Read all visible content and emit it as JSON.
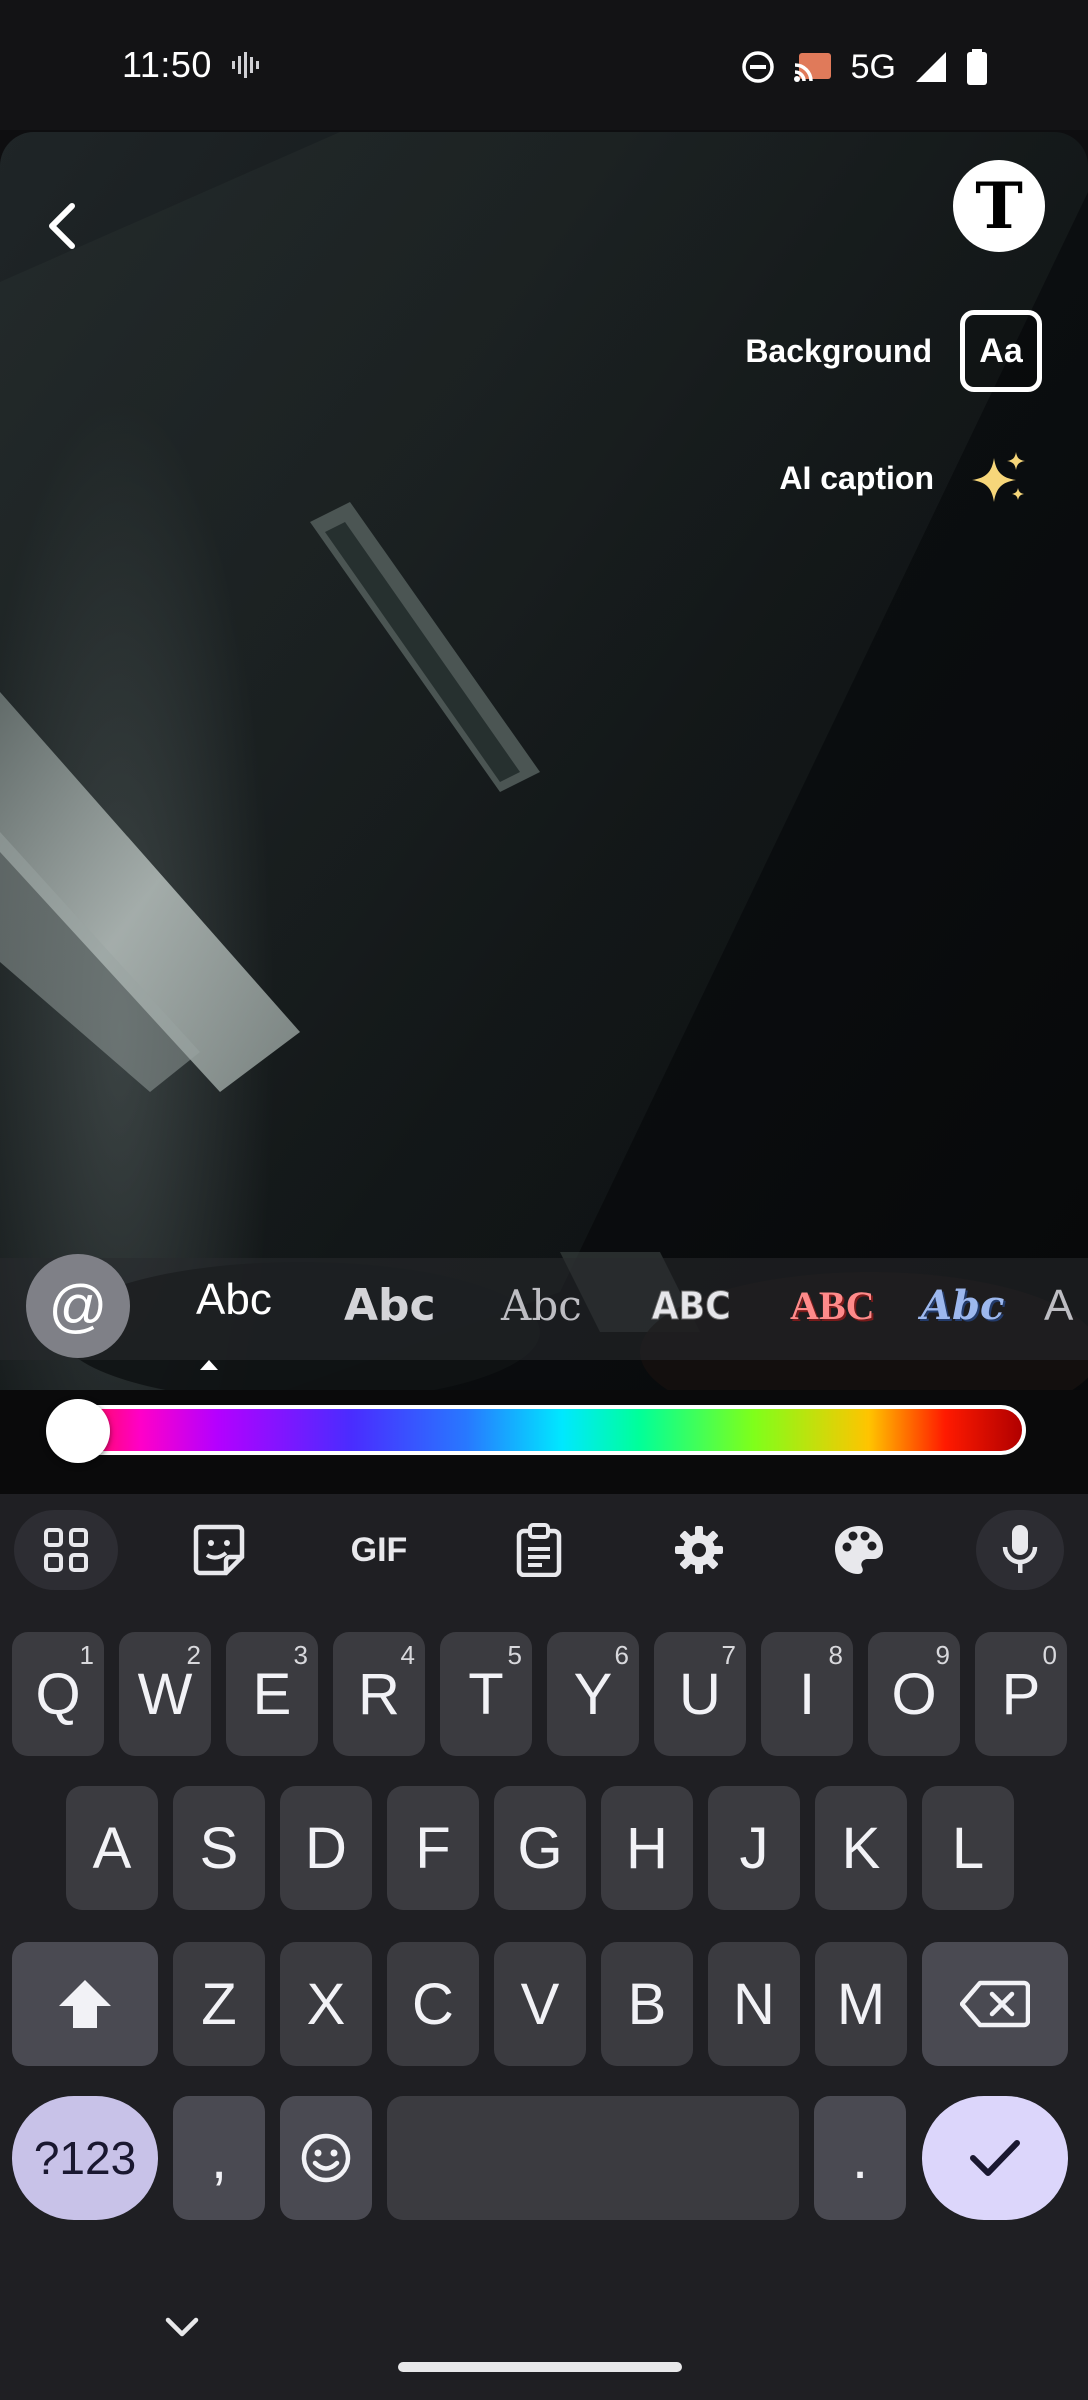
{
  "status_bar": {
    "time": "11:50",
    "network": "5G",
    "icons": [
      "sound-wave-icon",
      "do-not-disturb-icon",
      "cast-icon",
      "signal-icon",
      "battery-icon"
    ]
  },
  "editor": {
    "background_label": "Background",
    "background_icon_text": "Aa",
    "ai_caption_label": "AI caption",
    "text_style_icon_text": "T",
    "text_value": "",
    "mention_symbol": "@"
  },
  "font_options": [
    {
      "label": "Abc",
      "style": "regular",
      "selected": true
    },
    {
      "label": "Abc",
      "style": "bold",
      "selected": false
    },
    {
      "label": "Abc",
      "style": "typewriter",
      "selected": false
    },
    {
      "label": "ABC",
      "style": "condensed-bold",
      "selected": false
    },
    {
      "label": "ABC",
      "style": "red-gradient",
      "selected": false
    },
    {
      "label": "Abc",
      "style": "blackletter",
      "selected": false
    },
    {
      "label": "A",
      "style": "partial",
      "selected": false
    }
  ],
  "color_slider": {
    "value": 0.0
  },
  "keyboard": {
    "toolbar": {
      "gif_label": "GIF"
    },
    "row1": [
      {
        "label": "Q",
        "hint": "1"
      },
      {
        "label": "W",
        "hint": "2"
      },
      {
        "label": "E",
        "hint": "3"
      },
      {
        "label": "R",
        "hint": "4"
      },
      {
        "label": "T",
        "hint": "5"
      },
      {
        "label": "Y",
        "hint": "6"
      },
      {
        "label": "U",
        "hint": "7"
      },
      {
        "label": "I",
        "hint": "8"
      },
      {
        "label": "O",
        "hint": "9"
      },
      {
        "label": "P",
        "hint": "0"
      }
    ],
    "row2": [
      "A",
      "S",
      "D",
      "F",
      "G",
      "H",
      "J",
      "K",
      "L"
    ],
    "row3": [
      "Z",
      "X",
      "C",
      "V",
      "B",
      "N",
      "M"
    ],
    "symbols_label": "?123",
    "comma_label": ",",
    "period_label": "."
  }
}
